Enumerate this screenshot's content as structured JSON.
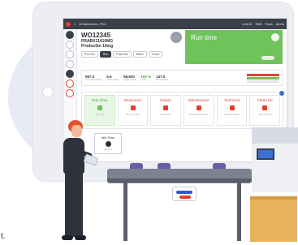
{
  "topbar": {
    "logo_text": "",
    "breadcrumb": "Dreamworks - Ph1",
    "right_items": [
      "Line10",
      "Shift",
      "Tools",
      "Alerts"
    ]
  },
  "header": {
    "work_order": "WO12345",
    "product_code": "PRABX11410MG",
    "product_name": "Productlin 10mg",
    "buttons": [
      "Pre Run",
      "Run",
      "Post Run",
      "Batch",
      "Count"
    ]
  },
  "runtime": {
    "title": "Run time"
  },
  "stats": [
    {
      "value": "597.0",
      "label": "Total Good Output"
    },
    {
      "value": "6.6",
      "label": "Actual Speed"
    },
    {
      "value": "58,600",
      "label": "Target Output"
    },
    {
      "value": "100 %",
      "label": "Quality"
    },
    {
      "value": "147.0",
      "label": "Run Duration"
    }
  ],
  "states": [
    {
      "label": "Run Time",
      "sub": "Run Time",
      "active": true
    },
    {
      "label": "Resources",
      "sub": "Resource Time",
      "active": false
    },
    {
      "label": "Failure",
      "sub": "Failure Time",
      "active": false
    },
    {
      "label": "Maintenance",
      "sub": "Planned Maintenance",
      "active": false
    },
    {
      "label": "Technical",
      "sub": "Technical Failure",
      "active": false
    },
    {
      "label": "Clean Up",
      "sub": "Clean Up Time",
      "active": false
    }
  ],
  "idle": {
    "label": "Idle Time",
    "sub": "Idle Time"
  },
  "caption": "t.",
  "colors": {
    "accent_green": "#70c25a",
    "accent_red": "#e2402f",
    "topbar": "#3b3f4a"
  }
}
